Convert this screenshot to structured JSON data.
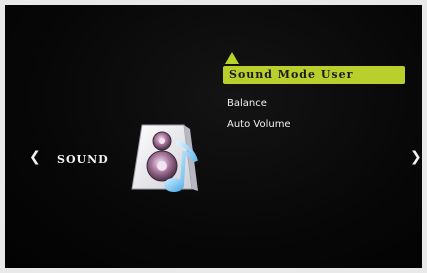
{
  "menu": {
    "section_label": "SOUND",
    "nav_left": "❮",
    "nav_right": "❯",
    "items": [
      {
        "label": "Sound Mode User",
        "selected": true
      },
      {
        "label": "Balance",
        "selected": false
      },
      {
        "label": "Auto Volume",
        "selected": false
      }
    ]
  },
  "icons": {
    "section_icon": "speaker-music-note-icon",
    "scroll_up": "up-triangle-icon"
  },
  "colors": {
    "highlight": "#b9cf2c",
    "text": "#f0f0f0",
    "background": "#050505"
  }
}
